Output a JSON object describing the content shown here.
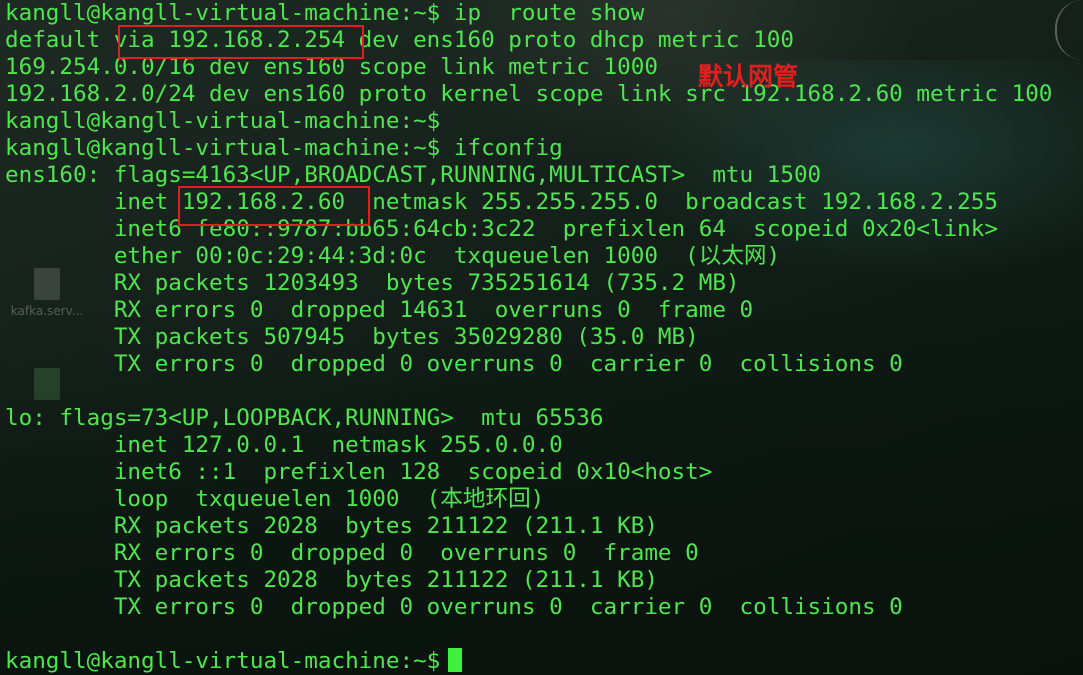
{
  "desktop": {
    "icons": [
      {
        "label": "kafka.serv..."
      },
      {
        "label": ""
      }
    ]
  },
  "terminal": {
    "lines": [
      "kangll@kangll-virtual-machine:~$ ip  route show",
      "default via 192.168.2.254 dev ens160 proto dhcp metric 100",
      "169.254.0.0/16 dev ens160 scope link metric 1000",
      "192.168.2.0/24 dev ens160 proto kernel scope link src 192.168.2.60 metric 100",
      "kangll@kangll-virtual-machine:~$",
      "kangll@kangll-virtual-machine:~$ ifconfig",
      "ens160: flags=4163<UP,BROADCAST,RUNNING,MULTICAST>  mtu 1500",
      "        inet 192.168.2.60  netmask 255.255.255.0  broadcast 192.168.2.255",
      "        inet6 fe80::9787:bb65:64cb:3c22  prefixlen 64  scopeid 0x20<link>",
      "        ether 00:0c:29:44:3d:0c  txqueuelen 1000  (以太网)",
      "        RX packets 1203493  bytes 735251614 (735.2 MB)",
      "        RX errors 0  dropped 14631  overruns 0  frame 0",
      "        TX packets 507945  bytes 35029280 (35.0 MB)",
      "        TX errors 0  dropped 0 overruns 0  carrier 0  collisions 0",
      "",
      "lo: flags=73<UP,LOOPBACK,RUNNING>  mtu 65536",
      "        inet 127.0.0.1  netmask 255.0.0.0",
      "        inet6 ::1  prefixlen 128  scopeid 0x10<host>",
      "        loop  txqueuelen 1000  (本地环回)",
      "        RX packets 2028  bytes 211122 (211.1 KB)",
      "        RX errors 0  dropped 0  overruns 0  frame 0",
      "        TX packets 2028  bytes 211122 (211.1 KB)",
      "        TX errors 0  dropped 0 overruns 0  carrier 0  collisions 0",
      "",
      "kangll@kangll-virtual-machine:~$"
    ]
  },
  "annotations": {
    "gateway_label": "默认网管"
  },
  "colors": {
    "terminal_text": "#4ee64e",
    "annotation": "#e02020",
    "cursor": "#3ef03e"
  }
}
